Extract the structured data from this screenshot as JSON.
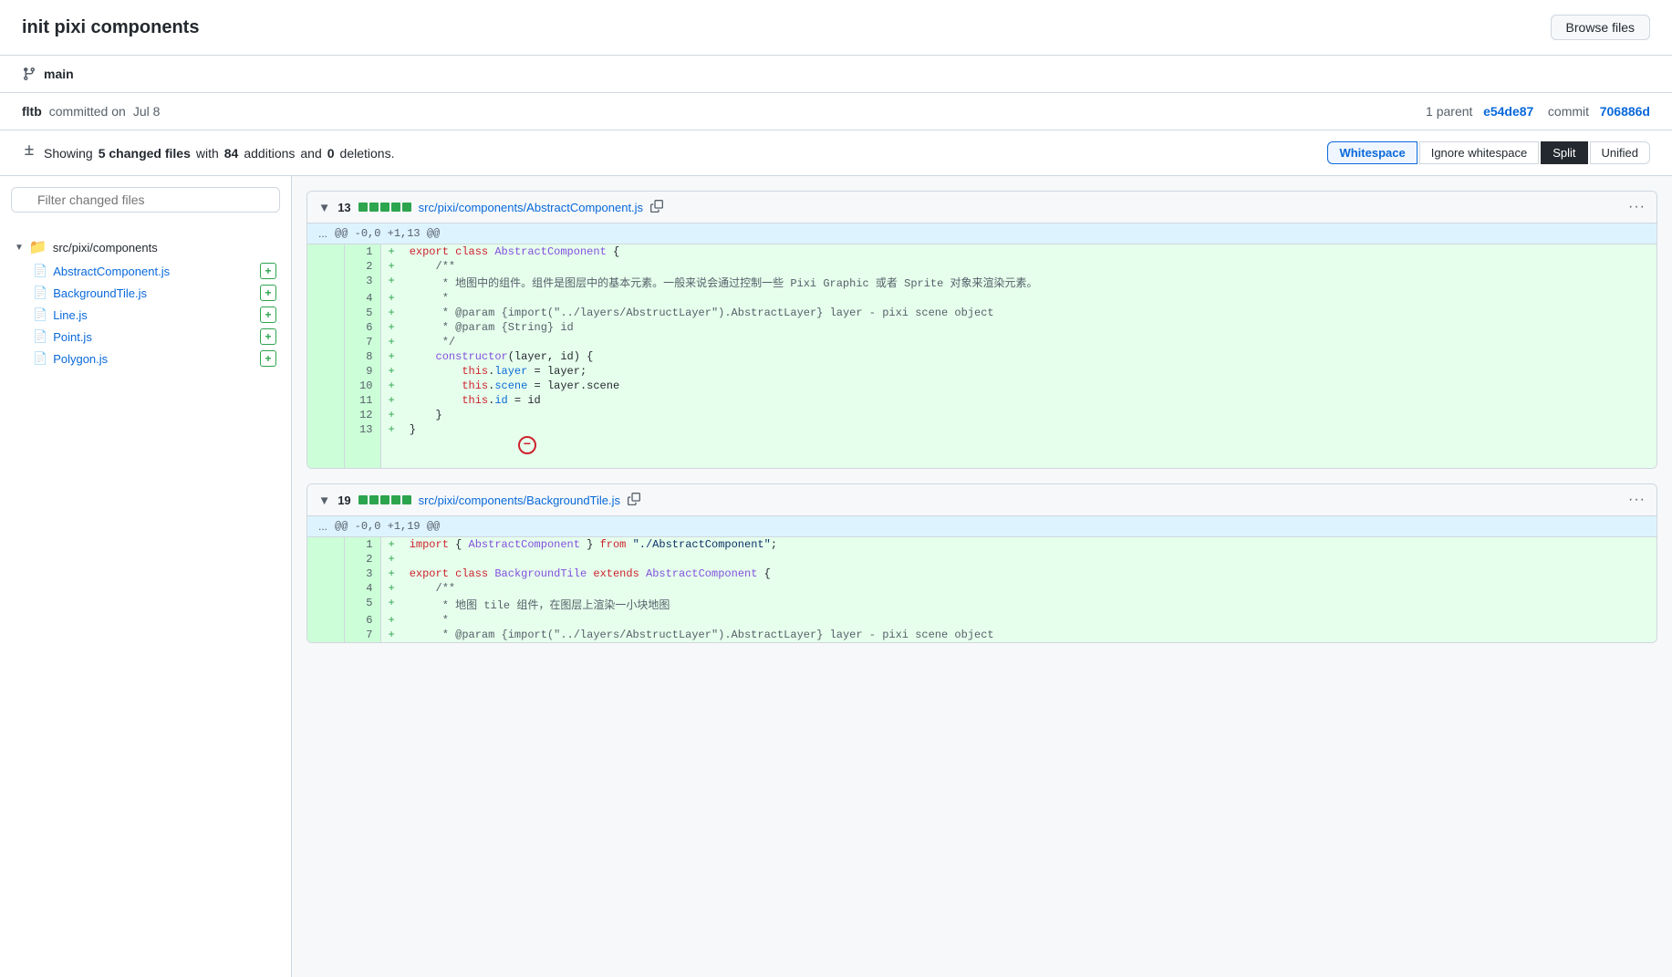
{
  "header": {
    "title": "init pixi components",
    "browse_files_label": "Browse files"
  },
  "commit_meta": {
    "branch": "main",
    "author": "fltb",
    "action": "committed on",
    "date": "Jul 8",
    "parent_label": "1 parent",
    "parent_hash": "e54de87",
    "commit_label": "commit",
    "commit_hash": "706886d"
  },
  "stats": {
    "showing": "Showing",
    "changed_count": "5",
    "changed_label": "changed files",
    "with_label": "with",
    "additions_count": "84",
    "additions_label": "additions",
    "and_label": "and",
    "deletions_count": "0",
    "deletions_label": "deletions."
  },
  "diff_controls": {
    "whitespace_label": "Whitespace",
    "ignore_label": "Ignore whitespace",
    "split_label": "Split",
    "unified_label": "Unified"
  },
  "sidebar": {
    "search_placeholder": "Filter changed files",
    "folder": "src/pixi/components",
    "files": [
      {
        "name": "AbstractComponent.js"
      },
      {
        "name": "BackgroundTile.js"
      },
      {
        "name": "Line.js"
      },
      {
        "name": "Point.js"
      },
      {
        "name": "Polygon.js"
      }
    ]
  },
  "diff_blocks": [
    {
      "id": "abstract",
      "count": "13",
      "filename": "src/pixi/components/AbstractComponent.js",
      "hunk": "@@ -0,0 +1,13 @@",
      "lines": [
        {
          "num": "1",
          "marker": "+",
          "content": "export class AbstractComponent {"
        },
        {
          "num": "2",
          "marker": "+",
          "content": "    /**"
        },
        {
          "num": "3",
          "marker": "+",
          "content": "     * 地图中的组件。组件是图层中的基本元素。一般来说会通过控制一些 Pixi Graphic 或者 Sprite 对象来渲染元素。"
        },
        {
          "num": "4",
          "marker": "+",
          "content": "     *"
        },
        {
          "num": "5",
          "marker": "+",
          "content": "     * @param {import(\"../layers/AbstructLayer\").AbstractLayer} layer - pixi scene object"
        },
        {
          "num": "6",
          "marker": "+",
          "content": "     * @param {String} id"
        },
        {
          "num": "7",
          "marker": "+",
          "content": "     */"
        },
        {
          "num": "8",
          "marker": "+",
          "content": "    constructor(layer, id) {"
        },
        {
          "num": "9",
          "marker": "+",
          "content": "        this.layer = layer;"
        },
        {
          "num": "10",
          "marker": "+",
          "content": "        this.scene = layer.scene"
        },
        {
          "num": "11",
          "marker": "+",
          "content": "        this.id = id"
        },
        {
          "num": "12",
          "marker": "+",
          "content": "    }"
        },
        {
          "num": "13",
          "marker": "+",
          "content": "}"
        }
      ]
    },
    {
      "id": "background",
      "count": "19",
      "filename": "src/pixi/components/BackgroundTile.js",
      "hunk": "@@ -0,0 +1,19 @@",
      "lines": [
        {
          "num": "1",
          "marker": "+",
          "content": "import { AbstractComponent } from \"./AbstractComponent\";"
        },
        {
          "num": "2",
          "marker": "+",
          "content": ""
        },
        {
          "num": "3",
          "marker": "+",
          "content": "export class BackgroundTile extends AbstractComponent {"
        },
        {
          "num": "4",
          "marker": "+",
          "content": "    /**"
        },
        {
          "num": "5",
          "marker": "+",
          "content": "     * 地图 tile 组件，在图层上渲染一小块地图"
        },
        {
          "num": "6",
          "marker": "+",
          "content": "     *"
        },
        {
          "num": "7",
          "marker": "+",
          "content": "     * @param {import(\"../layers/AbstructLayer\").AbstractLayer} layer - pixi scene object"
        }
      ]
    }
  ]
}
